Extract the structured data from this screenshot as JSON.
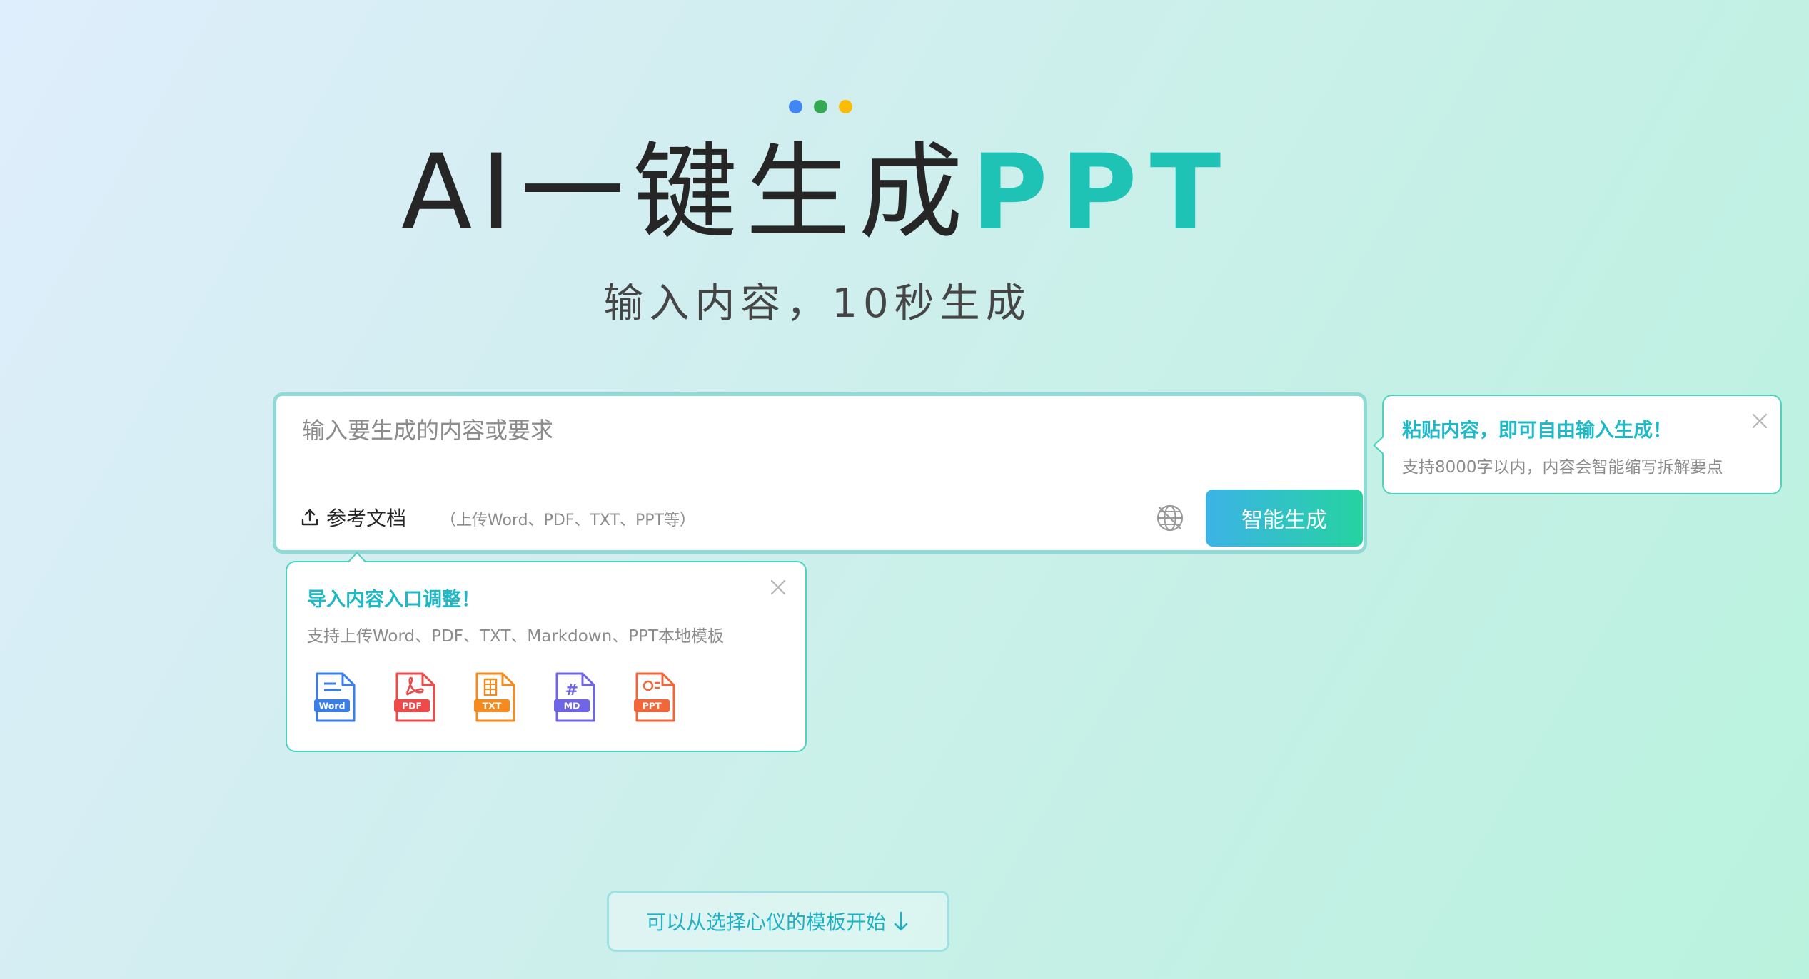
{
  "header": {
    "dots": [
      "#4285f4",
      "#34a853",
      "#fbbc05"
    ],
    "title_main": "AI一键生成",
    "title_accent": "PPT",
    "subtitle": "输入内容，10秒生成"
  },
  "input": {
    "placeholder": "输入要生成的内容或要求",
    "value": "",
    "ref_doc_label": "参考文档",
    "ref_doc_hint": "（上传Word、PDF、TXT、PPT等）",
    "generate_label": "智能生成"
  },
  "tip_paste": {
    "title": "粘贴内容，即可自由输入生成！",
    "desc": "支持8000字以内，内容会智能缩写拆解要点"
  },
  "tip_import": {
    "title": "导入内容入口调整！",
    "desc": "支持上传Word、PDF、TXT、Markdown、PPT本地模板",
    "file_types": [
      {
        "label": "Word",
        "color": "#3a7ee8",
        "icon": "word-file-icon"
      },
      {
        "label": "PDF",
        "color": "#ee4a4a",
        "icon": "pdf-file-icon"
      },
      {
        "label": "TXT",
        "color": "#f58a1f",
        "icon": "txt-file-icon"
      },
      {
        "label": "MD",
        "color": "#6f66e6",
        "icon": "md-file-icon"
      },
      {
        "label": "PPT",
        "color": "#f2673a",
        "icon": "ppt-file-icon"
      }
    ]
  },
  "footer": {
    "template_label": "可以从选择心仪的模板开始"
  },
  "colors": {
    "accent": "#1fc3b5",
    "tip_title": "#1fb8c7",
    "border": "#4fd2c0"
  }
}
